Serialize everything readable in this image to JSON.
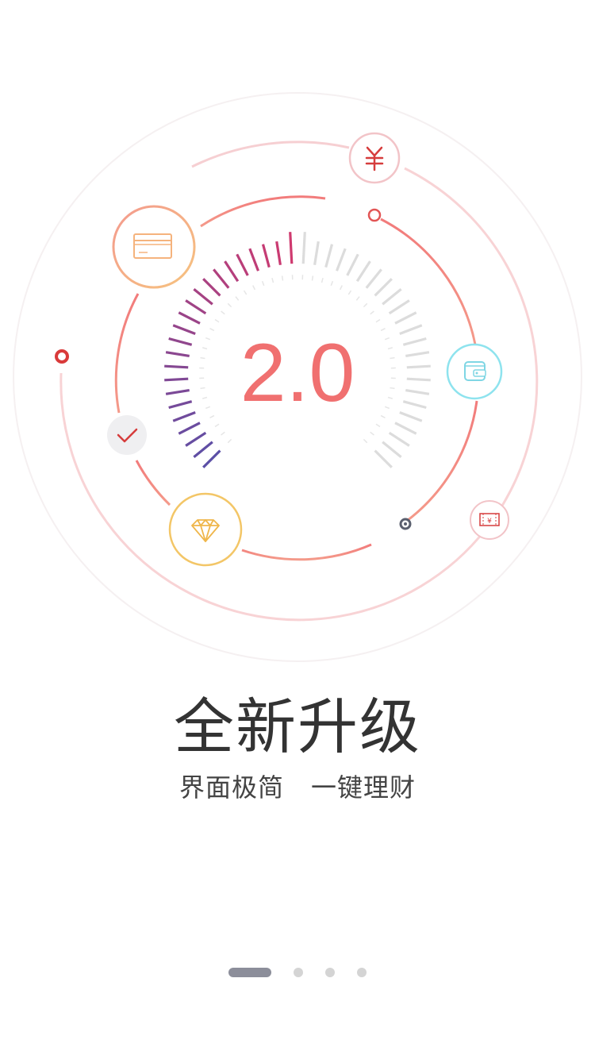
{
  "gauge": {
    "version_label": "2.0"
  },
  "intro": {
    "title": "全新升级",
    "subtitle_left": "界面极简",
    "subtitle_right": "一键理财"
  },
  "icons": [
    "yuan-icon",
    "bank-card-icon",
    "wallet-icon",
    "check-icon",
    "diamond-icon",
    "coupon-icon"
  ],
  "pager": {
    "page_count": 4,
    "active_index": 0
  },
  "colors": {
    "accent": "#f07070",
    "gauge_start": "#5b4fa6",
    "gauge_end": "#d23a6e",
    "card_orange": "#f4b88a",
    "wallet_cyan": "#8ee3ee",
    "diamond_yellow": "#f3c667",
    "dot_active": "#8c8e9a",
    "dot_inactive": "#d4d4d4"
  }
}
